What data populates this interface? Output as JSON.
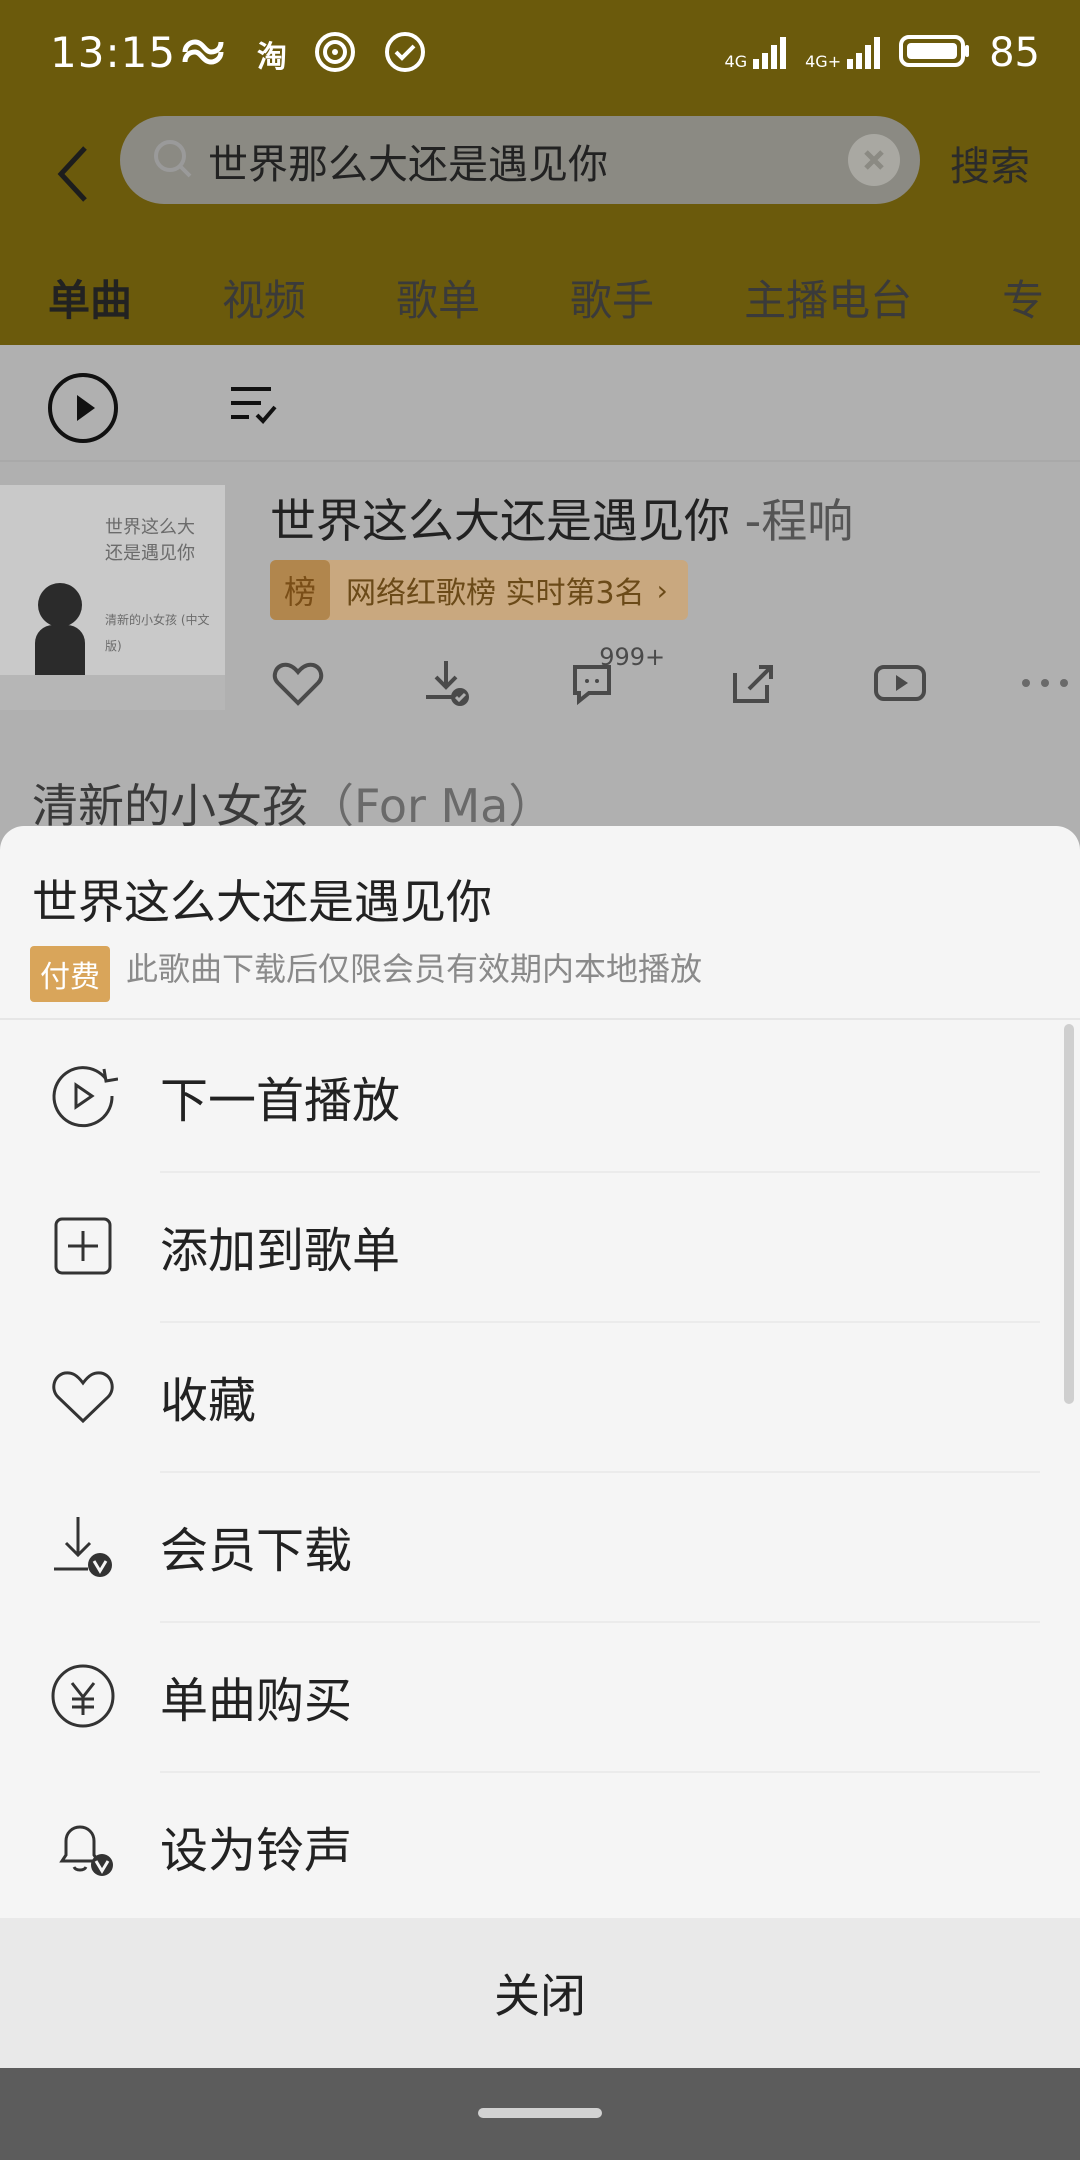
{
  "status_bar": {
    "time": "13:15",
    "battery": "85",
    "signal_labels": [
      "4G",
      "4G+"
    ]
  },
  "header": {
    "search_query": "世界那么大还是遇见你",
    "search_button": "搜索"
  },
  "tabs": [
    {
      "label": "单曲"
    },
    {
      "label": "视频"
    },
    {
      "label": "歌单"
    },
    {
      "label": "歌手"
    },
    {
      "label": "主播电台"
    },
    {
      "label": "专"
    }
  ],
  "song": {
    "title": "世界这么大还是遇见你",
    "artist": "-程响",
    "rank_badge": "榜",
    "rank_text": "网络红歌榜 实时第3名",
    "comment_count": "999+",
    "album_lines": [
      "世界这么大",
      "还是遇见你"
    ],
    "album_small": "清新的小女孩 (中文版)"
  },
  "next_song": {
    "title": "清新的小女孩",
    "subtitle": "（For Ma）"
  },
  "sheet": {
    "title": "世界这么大还是遇见你",
    "pay_badge": "付费",
    "pay_note": "此歌曲下载后仅限会员有效期内本地播放",
    "menu": [
      {
        "label": "下一首播放",
        "icon": "play-next-icon"
      },
      {
        "label": "添加到歌单",
        "icon": "add-to-playlist-icon"
      },
      {
        "label": "收藏",
        "icon": "heart-icon"
      },
      {
        "label": "会员下载",
        "icon": "vip-download-icon"
      },
      {
        "label": "单曲购买",
        "icon": "yuan-icon"
      },
      {
        "label": "设为铃声",
        "icon": "bell-vip-icon"
      }
    ],
    "close_label": "关闭"
  },
  "colors": {
    "header_bg": "#6b5a0c",
    "pay_badge": "#d9a55a"
  }
}
